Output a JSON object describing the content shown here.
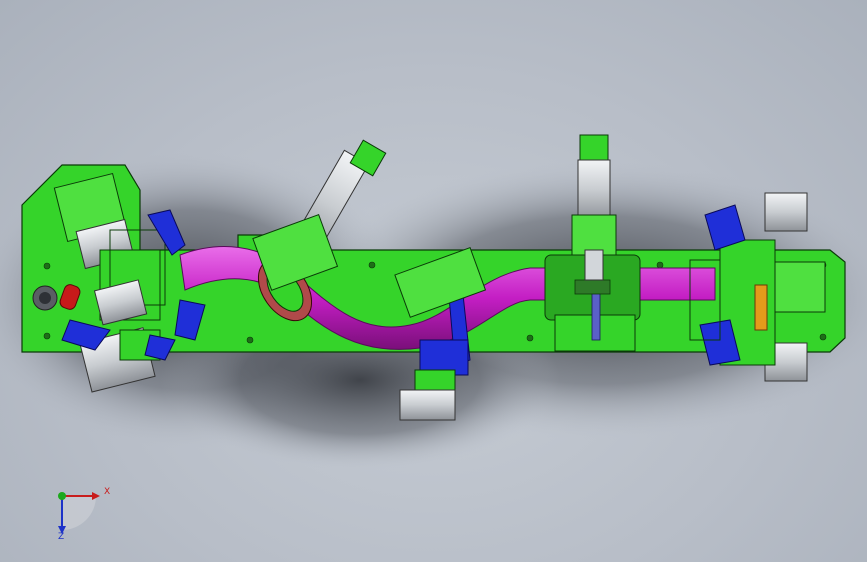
{
  "viewport": {
    "background": "#b8bec8"
  },
  "model": {
    "plate_color": "#35d42a",
    "pipe_color": "#c41ec4",
    "clamp_color": "#1f2fd8",
    "cylinder_color": "#d2d6da",
    "accent_color": "#e39b1b",
    "red_part_color": "#c71a1a"
  },
  "triad": {
    "x_label": "X",
    "z_label": "Z",
    "icon": "coordinate-triad-icon"
  }
}
